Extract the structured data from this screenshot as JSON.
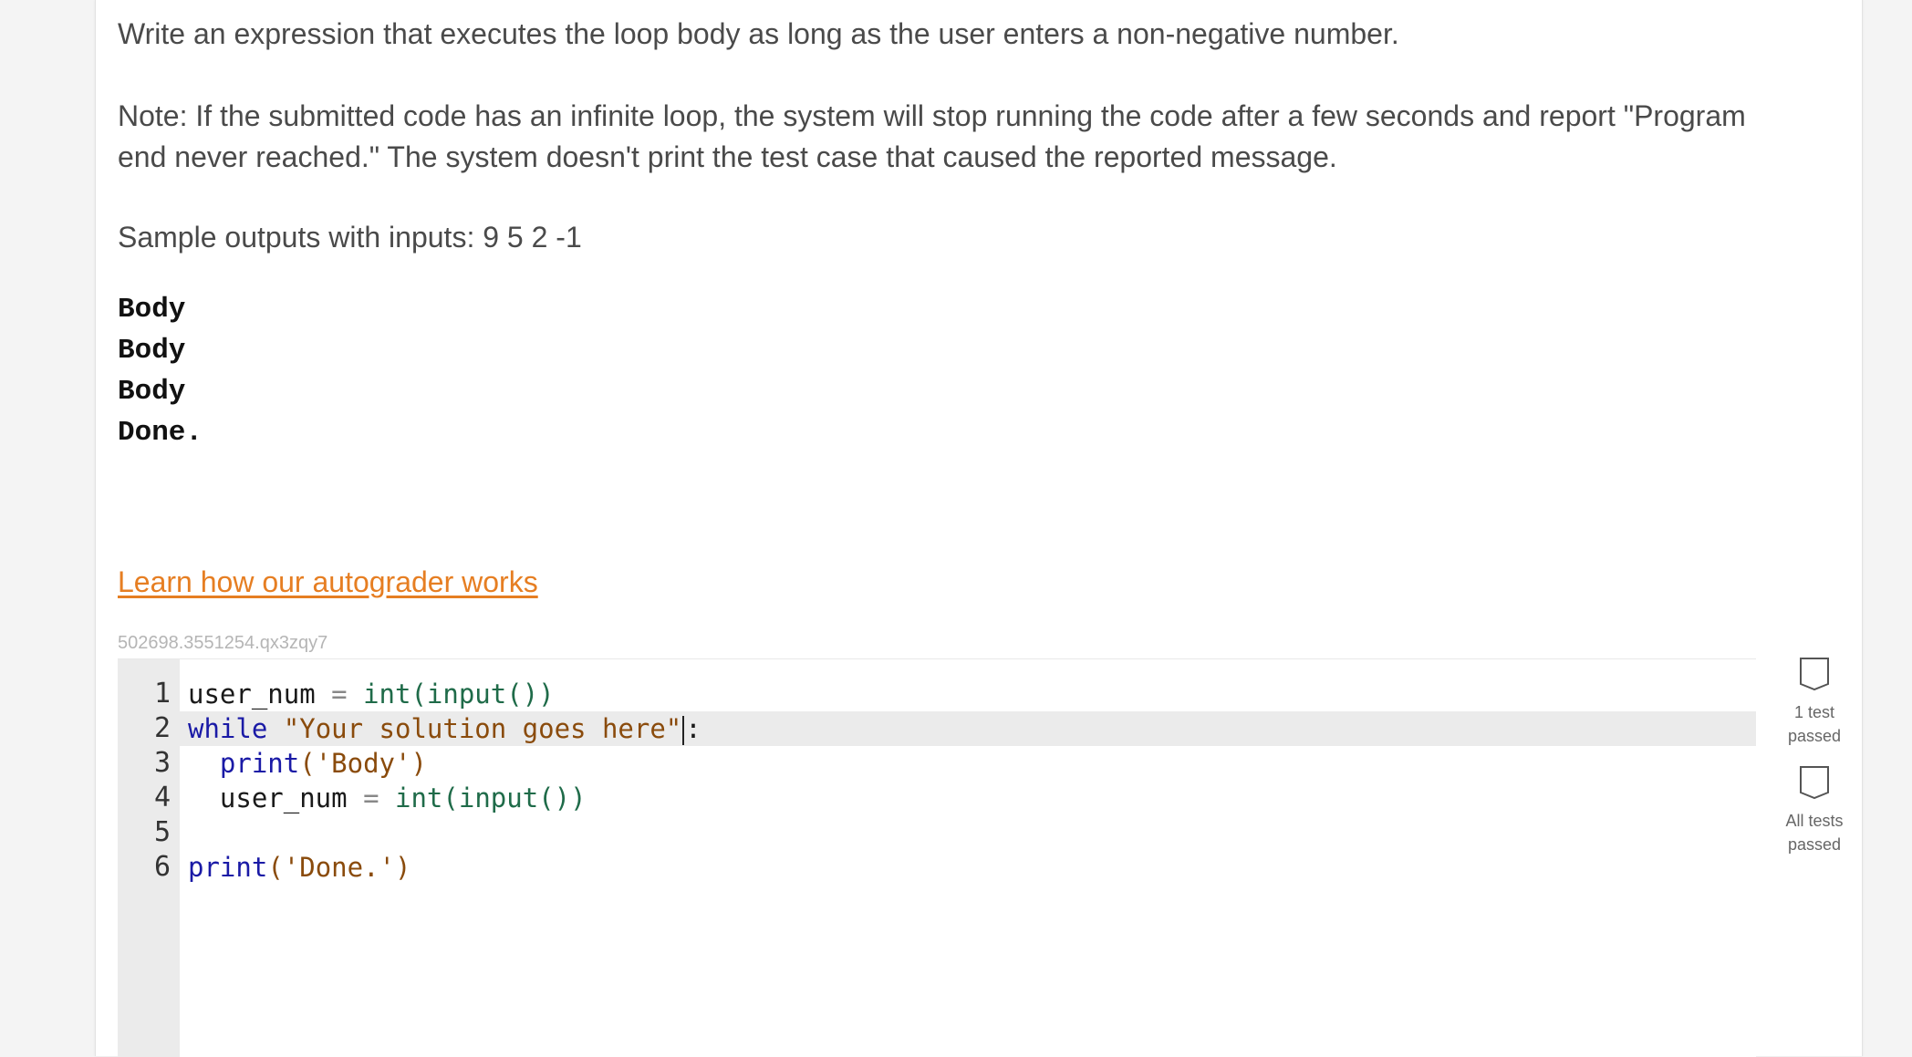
{
  "prompt": {
    "instruction": "Write an expression that executes the loop body as long as the user enters a non-negative number.",
    "note_line1": "Note: If the submitted code has an infinite loop, the system will stop running the code after a few seconds and report \"Program",
    "note_line2": "end never reached.\" The system doesn't print the test case that caused the reported message.",
    "sample_label": "Sample outputs with inputs: 9 5 2 -1"
  },
  "sample_output": [
    "Body",
    "Body",
    "Body",
    "Done."
  ],
  "autograder_link": "Learn how our autograder works",
  "challenge_id": "502698.3551254.qx3zqy7",
  "editor": {
    "line_numbers": [
      "1",
      "2",
      "3",
      "4",
      "5",
      "6"
    ],
    "active_line": 2,
    "code": {
      "l1_var": "user_num",
      "l1_eq": "=",
      "l1_call": "int(input())",
      "l2_kw": "while",
      "l2_str": "\"Your solution goes here\"",
      "l2_colon": ":",
      "l3_fn": "print",
      "l3_str": "('Body')",
      "l4_var": "user_num",
      "l4_eq": "=",
      "l4_call": "int(input())",
      "l6_fn": "print",
      "l6_str": "('Done.')"
    }
  },
  "status": {
    "test1_line1": "1 test",
    "test1_line2": "passed",
    "all_line1": "All tests",
    "all_line2": "passed"
  },
  "colors": {
    "link": "#e67e22",
    "keyword": "#1a1aa6",
    "string": "#8a4b0c",
    "function": "#1f6b49"
  }
}
